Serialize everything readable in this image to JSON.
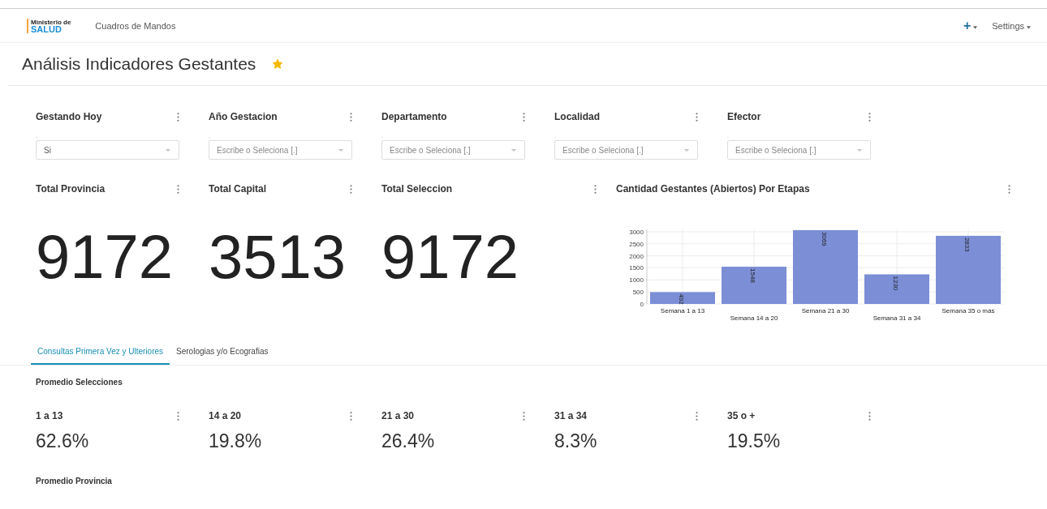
{
  "header": {
    "logo": {
      "line1": "Ministerio de",
      "line2": "SALUD"
    },
    "nav_link": "Cuadros de Mandos",
    "add_menu": "+",
    "settings_menu": "Settings"
  },
  "page": {
    "title": "Análisis Indicadores Gestantes",
    "starred": true
  },
  "filters": [
    {
      "title": "Gestando Hoy",
      "label": ".",
      "value": "Si"
    },
    {
      "title": "Año Gestacion",
      "label": ".",
      "placeholder": "Escribe o Seleciona [.]"
    },
    {
      "title": "Departamento",
      "label": ".",
      "placeholder": "Escribe o Seleciona [.]"
    },
    {
      "title": "Localidad",
      "label": ".",
      "placeholder": "Escribe o Seleciona [.]"
    },
    {
      "title": "Efector",
      "label": ".",
      "placeholder": "Escribe o Seleciona [.]"
    }
  ],
  "totals": [
    {
      "title": "Total Provincia",
      "value": "9172"
    },
    {
      "title": "Total Capital",
      "value": "3513"
    },
    {
      "title": "Total Seleccion",
      "value": "9172"
    }
  ],
  "chart_panel": {
    "title": "Cantidad Gestantes (Abiertos) Por Etapas",
    "chart_data": {
      "type": "bar",
      "categories": [
        "Semana 1 a 13",
        "Semana 14 a 20",
        "Semana 21 a 30",
        "Semana 31 a 34",
        "Semana 35 o más"
      ],
      "series": [
        {
          "color": "#7b8ed6",
          "values": [
            492,
            1548,
            3069,
            1230,
            2833
          ]
        }
      ],
      "ylim": [
        0,
        3100
      ],
      "yticks": [
        0,
        500,
        1000,
        1500,
        2000,
        2500,
        3000
      ],
      "grid": true,
      "data_labels": true
    }
  },
  "tabs": [
    {
      "label": "Consultas Primera Vez y Ulteriores",
      "selected": true
    },
    {
      "label": "Serologias y/o Ecografias",
      "selected": false
    }
  ],
  "sections": [
    {
      "title": "Promedio Selecciones",
      "kpis": [
        {
          "title": "1 a 13",
          "value": "62.6%"
        },
        {
          "title": "14 a 20",
          "value": "19.8%"
        },
        {
          "title": "21 a 30",
          "value": "26.4%"
        },
        {
          "title": "31 a 34",
          "value": "8.3%"
        },
        {
          "title": "35 o +",
          "value": "19.5%"
        }
      ]
    },
    {
      "title": "Promedio Provincia"
    }
  ]
}
